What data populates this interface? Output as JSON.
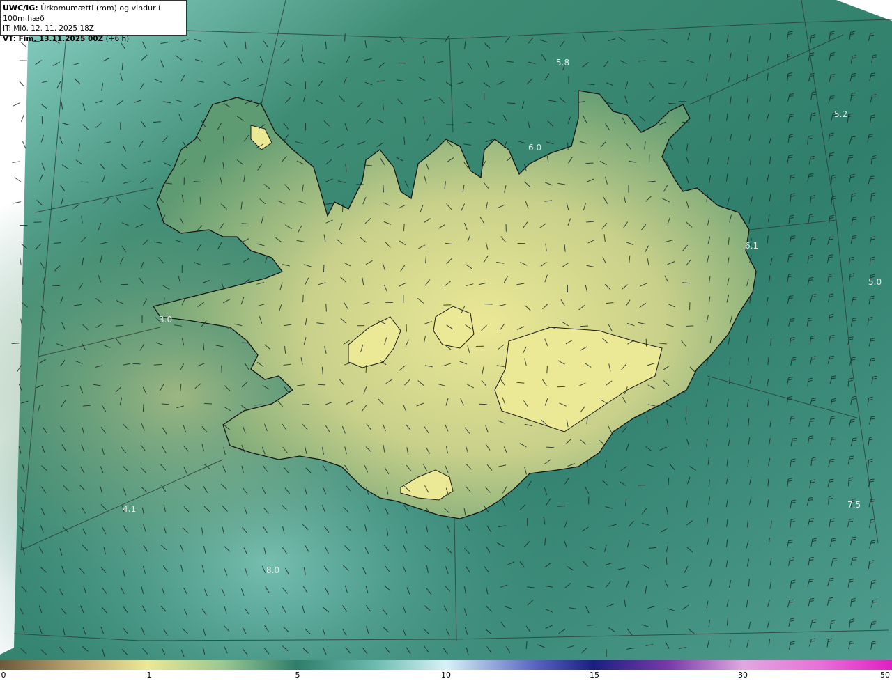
{
  "header": {
    "product": "UWC/IG:",
    "title": "Úrkomumætti (mm) og vindur í 100m hæð",
    "it_line": "IT: Mið. 12. 11. 2025 18Z",
    "vt_prefix": "VT: Fim. 13.11.2025 00Z",
    "vt_suffix": "(+6 h)"
  },
  "map_labels": [
    {
      "text": "5.8"
    },
    {
      "text": "5.2"
    },
    {
      "text": "6.0"
    },
    {
      "text": "6.1"
    },
    {
      "text": "5.0"
    },
    {
      "text": "3.0"
    },
    {
      "text": "4.1"
    },
    {
      "text": "7.5"
    },
    {
      "text": "8.0"
    }
  ],
  "colorbar": {
    "ticks": [
      "0",
      "1",
      "5",
      "10",
      "15",
      "30",
      "50"
    ],
    "colors": [
      "#6b5a3a",
      "#c8b07a",
      "#e8e49a",
      "#2f7d6a",
      "#9ad8d4",
      "#d8f0f8",
      "#1a2080",
      "#8020a0",
      "#e0a0e0",
      "#e020c0"
    ]
  },
  "colors": {
    "sea": "#3a8a7a",
    "land_low": "#5a9a70",
    "land_high": "#e0e08c",
    "coast": "#1a1a1a",
    "grid": "#333333"
  }
}
